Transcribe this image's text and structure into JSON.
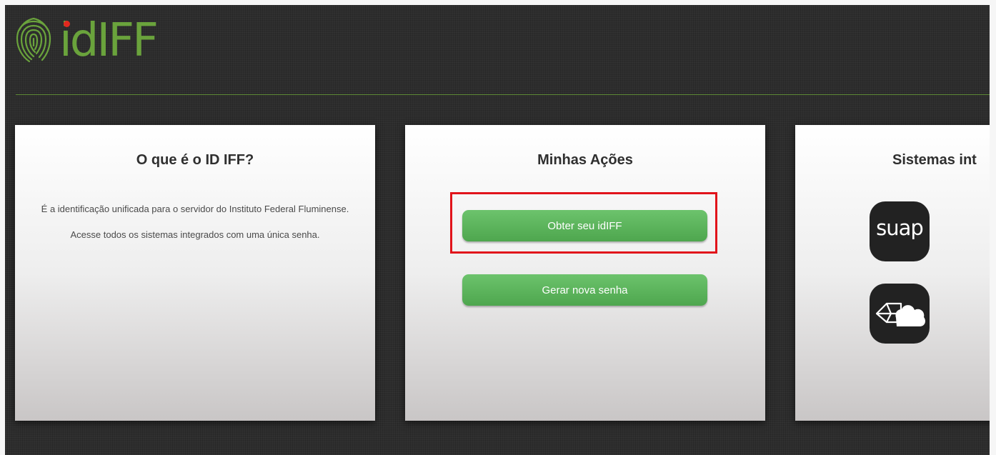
{
  "brand": {
    "logo_text": "idIFF",
    "logo_icon": "fingerprint-icon",
    "colors": {
      "green": "#6aa33c",
      "dot_red": "#e2281f",
      "rule": "#5e8a36"
    }
  },
  "cards": {
    "about": {
      "title": "O que é o ID IFF?",
      "paragraph1": "É a identificação unificada para o servidor do Instituto Federal Fluminense.",
      "paragraph2": "Acesse todos os sistemas integrados com uma única senha."
    },
    "actions": {
      "title": "Minhas Ações",
      "obter_label": "Obter seu idIFF",
      "gerar_label": "Gerar nova senha",
      "highlight_color": "#e1141b",
      "button_color": "#5cb85c"
    },
    "systems": {
      "title": "Sistemas int",
      "items": [
        {
          "label": "suap",
          "icon": "suap-logo-icon"
        },
        {
          "icon": "cloud-box-icon"
        }
      ]
    }
  }
}
